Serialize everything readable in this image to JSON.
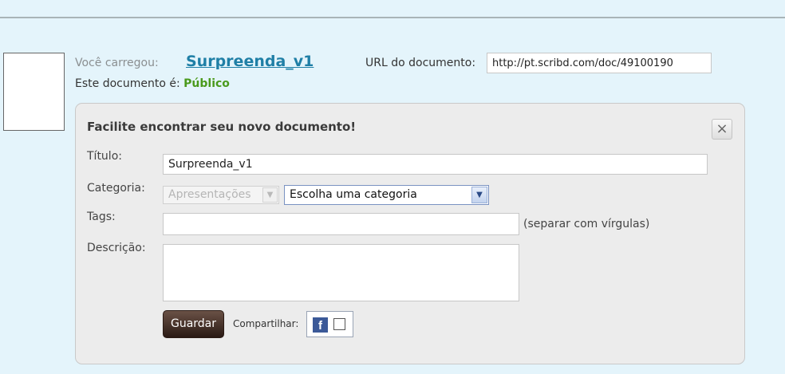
{
  "header": {
    "uploaded_label": "Você carregou:",
    "document_title": "Surpreenda_v1",
    "status_label": "Este documento é:",
    "status_value": "Público",
    "url_label": "URL do documento:",
    "url_value": "http://pt.scribd.com/doc/49100190"
  },
  "panel": {
    "title": "Facilite encontrar seu novo documento!",
    "close_icon": "close-icon",
    "title_label": "Título:",
    "title_value": "Surpreenda_v1",
    "category_label": "Categoria:",
    "category_disabled_value": "Apresentações",
    "category_select_value": "Escolha uma categoria",
    "tags_label": "Tags:",
    "tags_value": "",
    "tags_hint": "(separar com vírgulas)",
    "description_label": "Descrição:",
    "description_value": "",
    "save_label": "Guardar",
    "share_label": "Compartilhar:",
    "share_icon": "facebook-icon"
  },
  "colors": {
    "background": "#e4f4fb",
    "link": "#1f7fa6",
    "public_status": "#4a9a1c",
    "facebook": "#3b5998"
  }
}
